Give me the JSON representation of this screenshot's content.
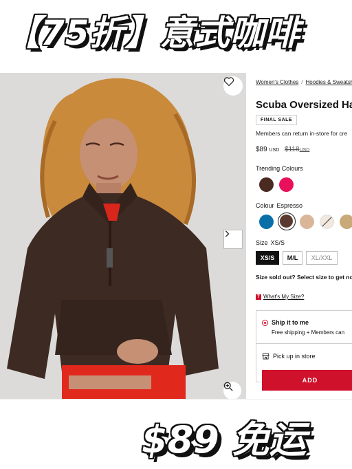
{
  "banner_top": {
    "text": "【75折】意式咖啡"
  },
  "banner_bottom": {
    "text": "$89 免运"
  },
  "breadcrumb": {
    "items": [
      "Women's Clothes",
      "Hoodies & Sweatshirt"
    ],
    "separator": "/"
  },
  "product": {
    "title": "Scuba Oversized Ha",
    "badge": "FINAL SALE",
    "members_note": "Members can return in-store for cre",
    "price": "$89",
    "currency": "USD",
    "old_price": "$118",
    "old_currency": "USD"
  },
  "trending": {
    "label": "Trending Colours",
    "swatches": [
      {
        "name": "espresso",
        "color": "#4a2a20"
      },
      {
        "name": "pink",
        "color": "#e8105a"
      }
    ]
  },
  "colour": {
    "label": "Colour",
    "selected": "Espresso",
    "swatches": [
      {
        "name": "blue",
        "color": "#0a6fa8"
      },
      {
        "name": "espresso",
        "color": "#5a3a30"
      },
      {
        "name": "tan",
        "color": "#d9b69a"
      },
      {
        "name": "cream",
        "color": "#f3e8df"
      },
      {
        "name": "khaki",
        "color": "#c9a978"
      }
    ]
  },
  "size": {
    "label": "Size",
    "selected": "XS/S",
    "options": [
      "XS/S",
      "M/L",
      "XL/XXL"
    ],
    "soldout_note": "Size sold out? Select size to get no",
    "whats_my_size": "What's My Size?"
  },
  "fulfillment": {
    "ship_title": "Ship it to me",
    "ship_sub": "Free shipping + Members can",
    "pickup": "Pick up in store",
    "add_button": "ADD"
  },
  "colors": {
    "accent": "#d0112b",
    "hoodie": "#3d2a22"
  }
}
